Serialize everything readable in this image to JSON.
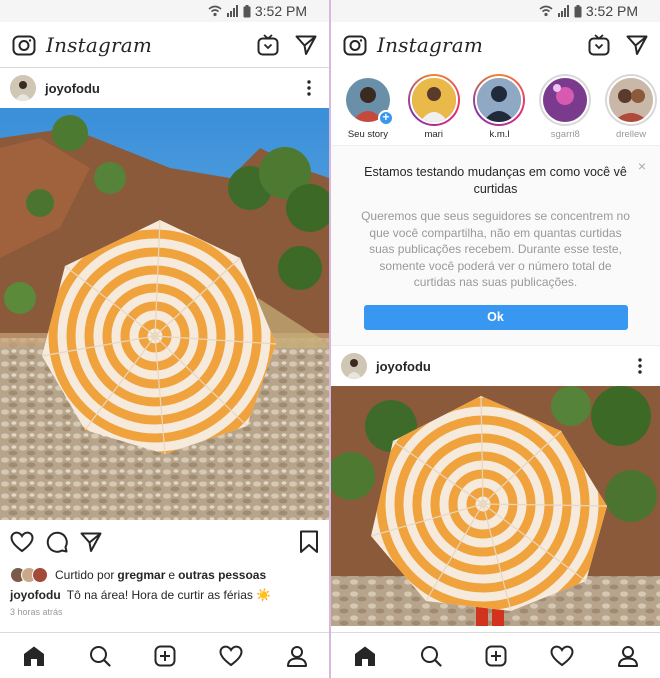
{
  "status": {
    "time": "3:52 PM"
  },
  "app": {
    "logo_text": "Instagram"
  },
  "post": {
    "username": "joyofodu",
    "liked_by_prefix": "Curtido por",
    "liked_by_user": "gregmar",
    "liked_by_conj": "e",
    "liked_by_rest": "outras pessoas",
    "caption_user": "joyofodu",
    "caption_text": "Tô na área! Hora de curtir as férias ☀️",
    "timestamp": "3 horas atrás"
  },
  "stories": [
    {
      "label": "Seu story",
      "own": true
    },
    {
      "label": "mari",
      "seen": false
    },
    {
      "label": "k.m.l",
      "seen": false
    },
    {
      "label": "sgarri8",
      "seen": true
    },
    {
      "label": "drellew",
      "seen": true
    }
  ],
  "notice": {
    "title": "Estamos testando mudanças em como você vê curtidas",
    "body": "Queremos que seus seguidores se concentrem no que você compartilha, não em quantas curtidas suas publicações recebem. Durante esse teste, somente você poderá ver o número total de curtidas nas suas publicações.",
    "button": "Ok",
    "close": "×"
  },
  "icons": {
    "camera": "camera-icon",
    "igtv": "igtv-icon",
    "direct": "direct-message-icon",
    "more": "more-options-icon",
    "like": "heart-icon",
    "comment": "comment-icon",
    "share": "share-icon",
    "save": "bookmark-icon",
    "home": "home-icon",
    "search": "search-icon",
    "add": "add-post-icon",
    "activity": "activity-heart-icon",
    "profile": "profile-icon"
  },
  "colors": {
    "accent": "#3897f0",
    "umbrella_orange": "#f0a23c",
    "story_ring": "#dd2a7b"
  }
}
